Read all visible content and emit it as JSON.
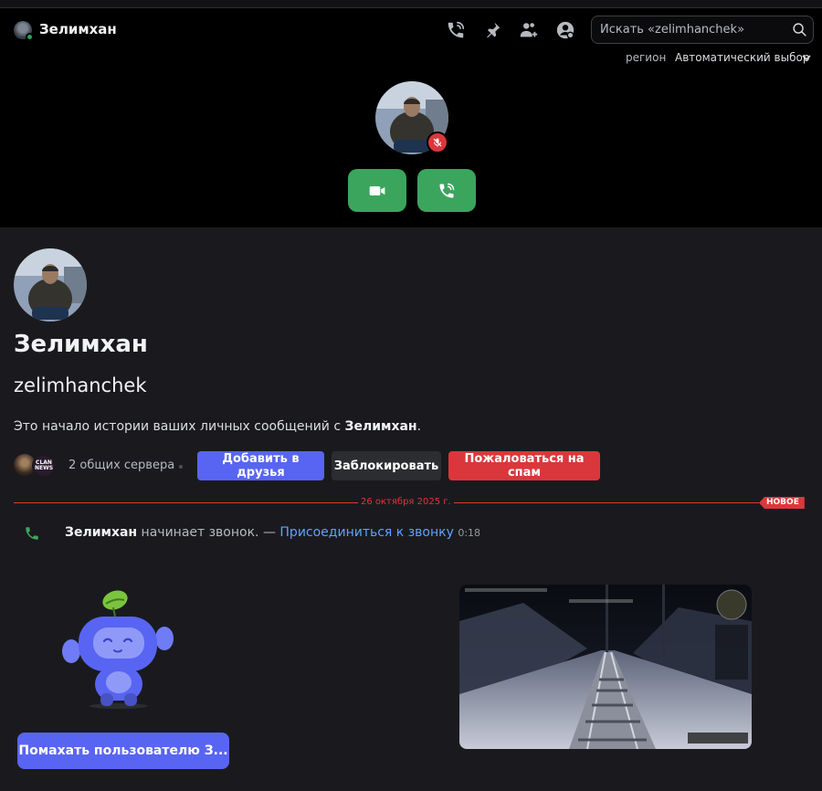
{
  "header": {
    "name": "Зелимхан",
    "search_placeholder": "Искать «zelimhanchek»",
    "icons": [
      "phone-call-icon",
      "pin-icon",
      "add-friend-icon",
      "profile-icon",
      "search-icon"
    ]
  },
  "call": {
    "region_label": "регион",
    "region_value": "Автоматический выбор"
  },
  "profile": {
    "display_name": "Зелимхан",
    "username": "zelimhanchek",
    "intro_prefix": "Это начало истории ваших личных сообщений с ",
    "intro_name": "Зелимхан",
    "intro_suffix": ".",
    "server_badge_text": "CLAN NEWS",
    "shared_servers": "2 общих сервера",
    "buttons": {
      "add_friend": "Добавить в друзья",
      "block": "Заблокировать",
      "report_spam": "Пожаловаться на спам"
    }
  },
  "divider": {
    "date": "26 октября 2025 г.",
    "new_badge": "НОВОЕ"
  },
  "message": {
    "author": "Зелимхан",
    "text": " начинает звонок. — ",
    "join_link": "Присоединиться к звонку",
    "time": "0:18"
  },
  "wave": {
    "button_label": "Помахать пользователю З..."
  },
  "colors": {
    "call_bg": "#000000",
    "chat_bg": "#1a1a1e",
    "green": "#3ba55d",
    "blurple": "#5865f2",
    "red": "#da373c",
    "link": "#5ea3ff"
  }
}
